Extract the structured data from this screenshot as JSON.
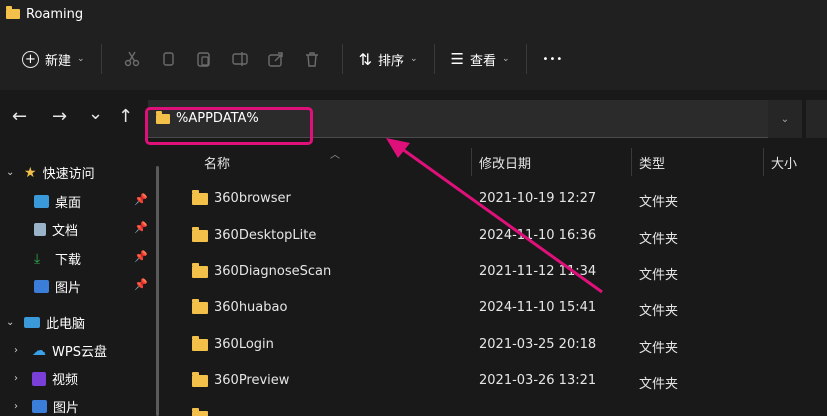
{
  "window": {
    "title": "Roaming"
  },
  "toolbar": {
    "new_label": "新建",
    "sort_label": "排序",
    "view_label": "查看",
    "more_label": "•••",
    "icons": [
      "cut-icon",
      "copy-icon",
      "paste-icon",
      "rename-icon",
      "share-icon",
      "delete-icon"
    ]
  },
  "nav": {
    "back": "←",
    "forward": "→",
    "recent": "⌄",
    "up": "↑"
  },
  "address": {
    "value": "%APPDATA%"
  },
  "sidebar": {
    "quick_access": "快速访问",
    "items": [
      {
        "label": "桌面",
        "color": "#3a9ad9"
      },
      {
        "label": "文档",
        "color": "#9ab3c9"
      },
      {
        "label": "下载",
        "color": "#2fa84f"
      },
      {
        "label": "图片",
        "color": "#3a7ed9"
      }
    ],
    "this_pc": "此电脑",
    "pc_items": [
      {
        "label": "WPS云盘",
        "color": "#3aa0e8"
      },
      {
        "label": "视频",
        "color": "#7b3fd9"
      },
      {
        "label": "图片",
        "color": "#3a7ed9"
      }
    ]
  },
  "columns": {
    "name": "名称",
    "date": "修改日期",
    "type": "类型",
    "size": "大小"
  },
  "files": [
    {
      "name": "360browser",
      "date": "2021-10-19 12:27",
      "type": "文件夹"
    },
    {
      "name": "360DesktopLite",
      "date": "2024-11-10 16:36",
      "type": "文件夹"
    },
    {
      "name": "360DiagnoseScan",
      "date": "2021-11-12 11:34",
      "type": "文件夹"
    },
    {
      "name": "360huabao",
      "date": "2024-11-10 15:41",
      "type": "文件夹"
    },
    {
      "name": "360Login",
      "date": "2021-03-25 20:18",
      "type": "文件夹"
    },
    {
      "name": "360Preview",
      "date": "2021-03-26 13:21",
      "type": "文件夹"
    }
  ],
  "colors": {
    "highlight": "#e0107a",
    "folder": "#f3c14a"
  }
}
